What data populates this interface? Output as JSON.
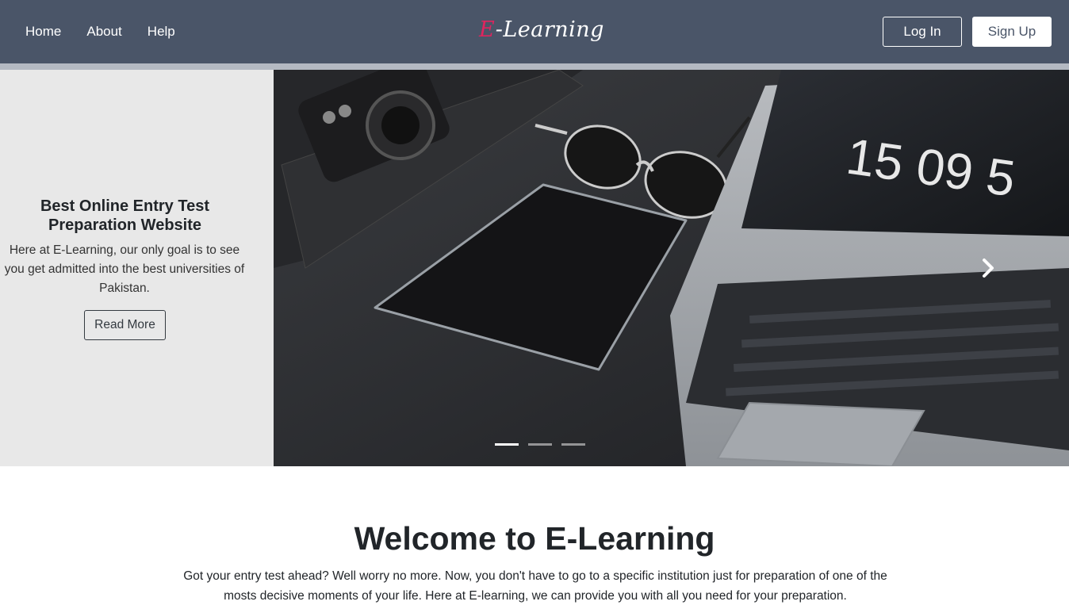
{
  "nav": {
    "links": [
      "Home",
      "About",
      "Help"
    ],
    "brand_prefix": "E",
    "brand_suffix": "-Learning",
    "login_label": "Log In",
    "signup_label": "Sign Up"
  },
  "hero": {
    "title": "Best Online Entry Test Preparation Website",
    "text": "Here at E-Learning, our only goal is to see you get admitted into the best universities of Pakistan.",
    "button_label": "Read More",
    "clock_text": "15 09 5"
  },
  "carousel": {
    "slide_count": 3,
    "active_index": 0,
    "next_icon": "chevron-right-icon"
  },
  "welcome": {
    "title": "Welcome to E-Learning",
    "text": "Got your entry test ahead? Well worry no more. Now, you don't have to go to a specific institution just for preparation of one of the mosts decisive moments of your life. Here at E-learning, we can provide you with all you need for your preparation."
  },
  "colors": {
    "navbar": "#4a5568",
    "brand_accent": "#e0245e",
    "panel": "#e8e8e8"
  }
}
